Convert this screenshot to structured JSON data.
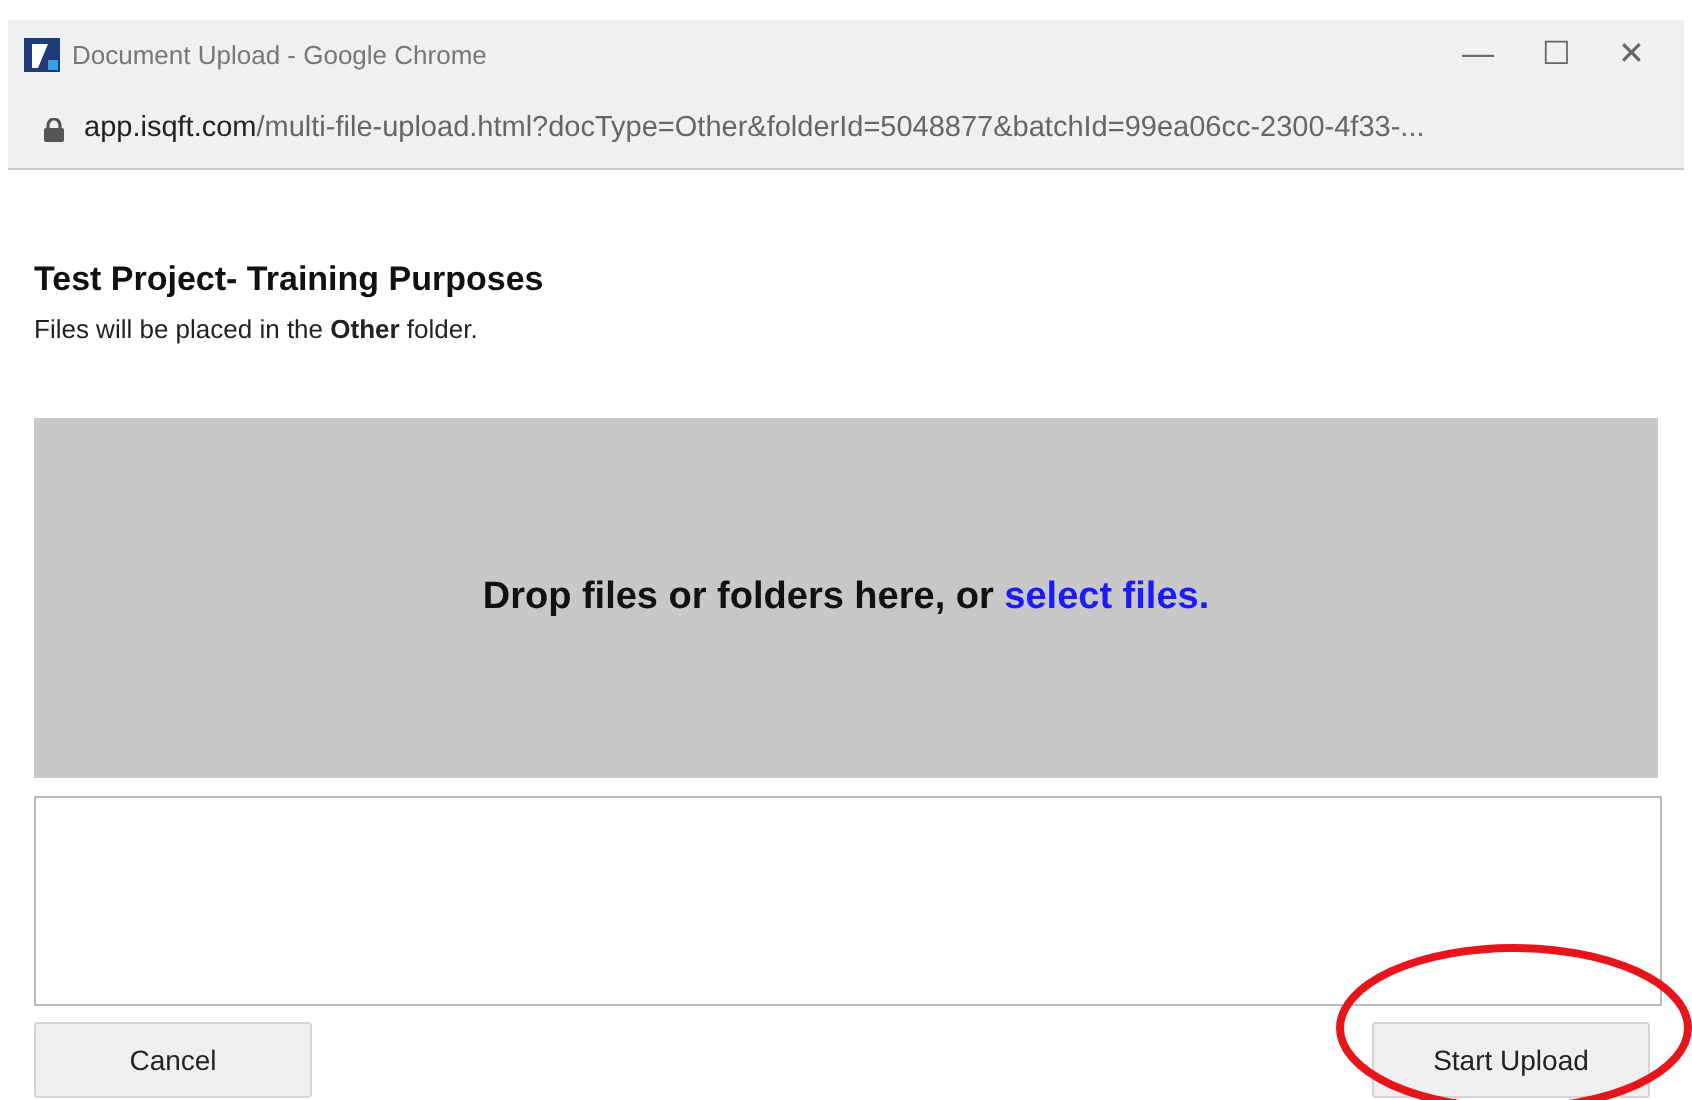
{
  "window": {
    "title": "Document Upload - Google Chrome",
    "controls": [
      "—",
      "☐",
      "✕"
    ]
  },
  "address_bar": {
    "host": "app.isqft.com",
    "path": "/multi-file-upload.html?docType=Other&folderId=5048877&batchId=99ea06cc-2300-4f33-..."
  },
  "heading": "Test Project- Training Purposes",
  "subtitle": "Files will be placed in the **Other** folder.",
  "dropzone": {
    "text": "Drop files or folders here, or",
    "link": "select files."
  },
  "buttons": [
    {
      "label": "Cancel",
      "kind": "cancel"
    },
    {
      "label": "Start Upload",
      "kind": "submit"
    }
  ],
  "annotation": {
    "kind": "ellipse"
  }
}
